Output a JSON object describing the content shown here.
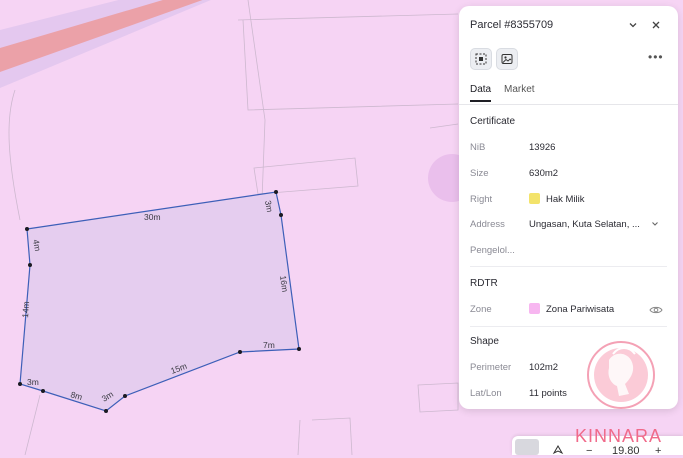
{
  "map": {
    "edge_labels": [
      "30m",
      "3m",
      "4m",
      "16m",
      "14m",
      "7m",
      "15m",
      "3m",
      "8m",
      "3m"
    ]
  },
  "panel": {
    "title": "Parcel #8355709",
    "tabs": [
      {
        "label": "Data",
        "active": true
      },
      {
        "label": "Market",
        "active": false
      }
    ],
    "certificate": {
      "heading": "Certificate",
      "rows": [
        {
          "label": "NiB",
          "value": "13926"
        },
        {
          "label": "Size",
          "value": "630m2"
        },
        {
          "label": "Right",
          "value": "Hak Milik",
          "swatch": "#f3e36b"
        },
        {
          "label": "Address",
          "value": "Ungasan, Kuta Selatan, ..."
        },
        {
          "label": "Pengelol...",
          "value": ""
        }
      ]
    },
    "rdtr": {
      "heading": "RDTR",
      "zone_label": "Zone",
      "zone_value": "Zona Pariwisata",
      "zone_swatch": "#f7b6f0"
    },
    "shape": {
      "heading": "Shape",
      "perimeter_label": "Perimeter",
      "perimeter_value": "102m2",
      "latlon_label": "Lat/Lon",
      "latlon_value": "11 points"
    }
  },
  "bottom_bar": {
    "zoom_value": "19.80",
    "minus": "−",
    "plus": "+"
  },
  "watermark": {
    "text": "KINNARA",
    "color": "#f06a8a"
  }
}
